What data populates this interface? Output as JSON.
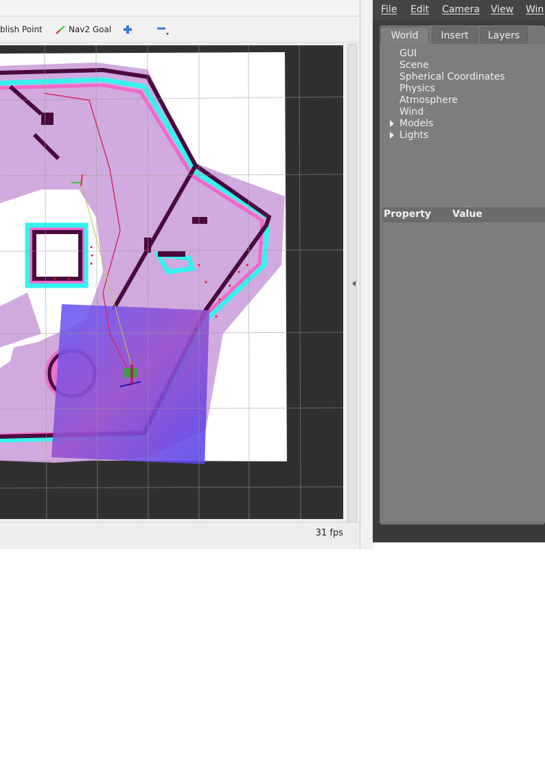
{
  "rviz": {
    "toolbar": {
      "publish_point_label": "blish Point",
      "nav2_goal_label": "Nav2 Goal",
      "add_tool_icon": "plus-icon",
      "remove_tool_icon": "minus-icon"
    },
    "status": {
      "fps": "31 fps"
    },
    "colors": {
      "viewport_bg": "#303030",
      "map_free": "#ffffff",
      "costmap_inflation": "#c79bd6",
      "costmap_cyan": "#35f2ee",
      "costmap_pink": "#f067c8",
      "obstacle": "#4a0a3d",
      "local_costmap": "#5a4ff0"
    }
  },
  "gazebo": {
    "menu": {
      "file": "File",
      "edit": "Edit",
      "camera": "Camera",
      "view": "View",
      "window": "Win"
    },
    "tabs": [
      "World",
      "Insert",
      "Layers"
    ],
    "tree": {
      "gui": "GUI",
      "scene": "Scene",
      "spherical": "Spherical Coordinates",
      "physics": "Physics",
      "atmosphere": "Atmosphere",
      "wind": "Wind",
      "models": "Models",
      "lights": "Lights"
    },
    "properties": {
      "property_header": "Property",
      "value_header": "Value"
    }
  }
}
